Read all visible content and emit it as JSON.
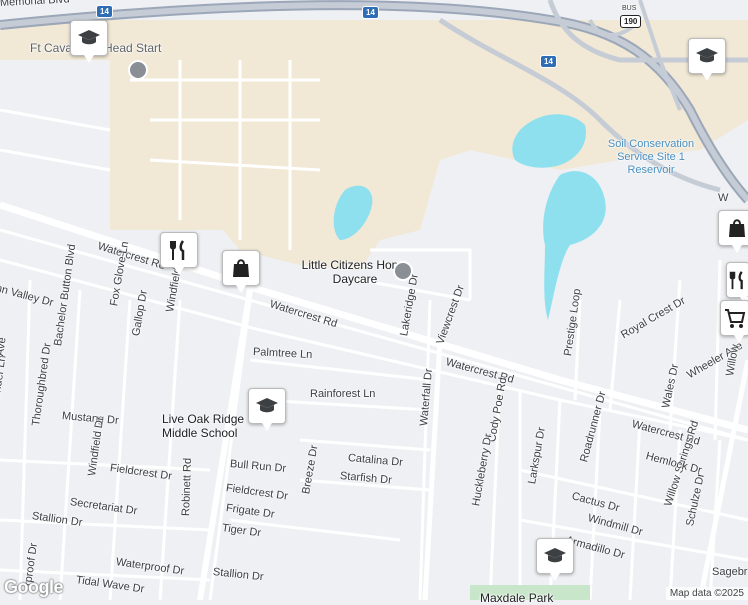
{
  "labels": {
    "memorial_blvd": "Memorial Blvd",
    "ft_cavazos": "Ft Cava",
    "head_start": "Head Start",
    "soil_conservation": "Soil Conservation Service Site 1 Reservoir",
    "little_citizens": "Little Citizens Home Daycare",
    "watercrest_rd_1": "Watercrest Rd",
    "watercrest_rd_2": "Watercrest Rd",
    "watercrest_rd_3": "Watercrest Rd",
    "watercrest_rd_4": "Watercrest Rd",
    "live_oak_ridge": "Live Oak Ridge Middle School",
    "lakeridge_dr": "Lakeridge Dr",
    "viewcrest_dr": "Viewcrest Dr",
    "waterfall_dr": "Waterfall Dr",
    "palmtree_ln": "Palmtree Ln",
    "rainforest_ln": "Rainforest Ln",
    "catalina_dr": "Catalina Dr",
    "starfish_dr": "Starfish Dr",
    "bull_run_dr": "Bull Run Dr",
    "breeze_dr": "Breeze Dr",
    "fieldcrest_dr_1": "Fieldcrest Dr",
    "fieldcrest_dr_2": "Fieldcrest Dr",
    "frigate_dr": "Frigate Dr",
    "tiger_dr": "Tiger Dr",
    "stallion_dr_1": "Stallion Dr",
    "stallion_dr_2": "Stallion Dr",
    "robinett_rd": "Robinett Rd",
    "secretariat_dr": "Secretariat Dr",
    "mustang_dr": "Mustang Dr",
    "windfield_dr_1": "Windfield Dr",
    "windfield_dr_2": "Windfield Dr",
    "thoroughbred_dr": "Thoroughbred Dr",
    "lavender_ln": "Lavender Ln",
    "gallop_dr": "Gallop Dr",
    "fox_glove_ln": "Fox Glove Ln",
    "bachelor_button_blvd": "Bachelor Button Blvd",
    "valley_dr": "nn Valley Dr",
    "waterproof_dr_1": "Waterproof Dr",
    "waterproof_dr_2": "rproof Dr",
    "tidal_wave_dr": "Tidal Wave Dr",
    "prestige_loop": "Prestige Loop",
    "royal_crest_dr": "Royal Crest Dr",
    "wales_dr": "Wales Dr",
    "wheeler_ave": "Wheeler Ave",
    "willow_springs_rd": "Willow Springs Rd",
    "hemlock_dr": "Hemlock Dr",
    "cody_poe_rd": "Cody Poe Rd",
    "huckleberry_dr": "Huckleberry Dr",
    "larkspur_dr": "Larkspur Dr",
    "roadrunner_dr": "Roadrunner Dr",
    "cactus_dr": "Cactus Dr",
    "windmill_dr": "Windmill Dr",
    "armadillo_dr": "Armadillo Dr",
    "schulze_dr": "Schulze Dr",
    "sagebr": "Sagebr",
    "maxdale_park": "Maxdale Park",
    "willow_edge": "Willow",
    "w_edge": "W",
    "ave_edge": "Ave"
  },
  "shields": {
    "i14_a": "14",
    "i14_b": "14",
    "i14_c": "14",
    "bus190": "190",
    "bus_label": "BUS"
  },
  "attribution": "Map data ©2025",
  "google_logo": "Google",
  "colors": {
    "land": "#eef0f3",
    "military": "#f0e8d6",
    "water": "#8ee0ef",
    "road": "#ffffff",
    "highway": "#9ba7b8"
  }
}
